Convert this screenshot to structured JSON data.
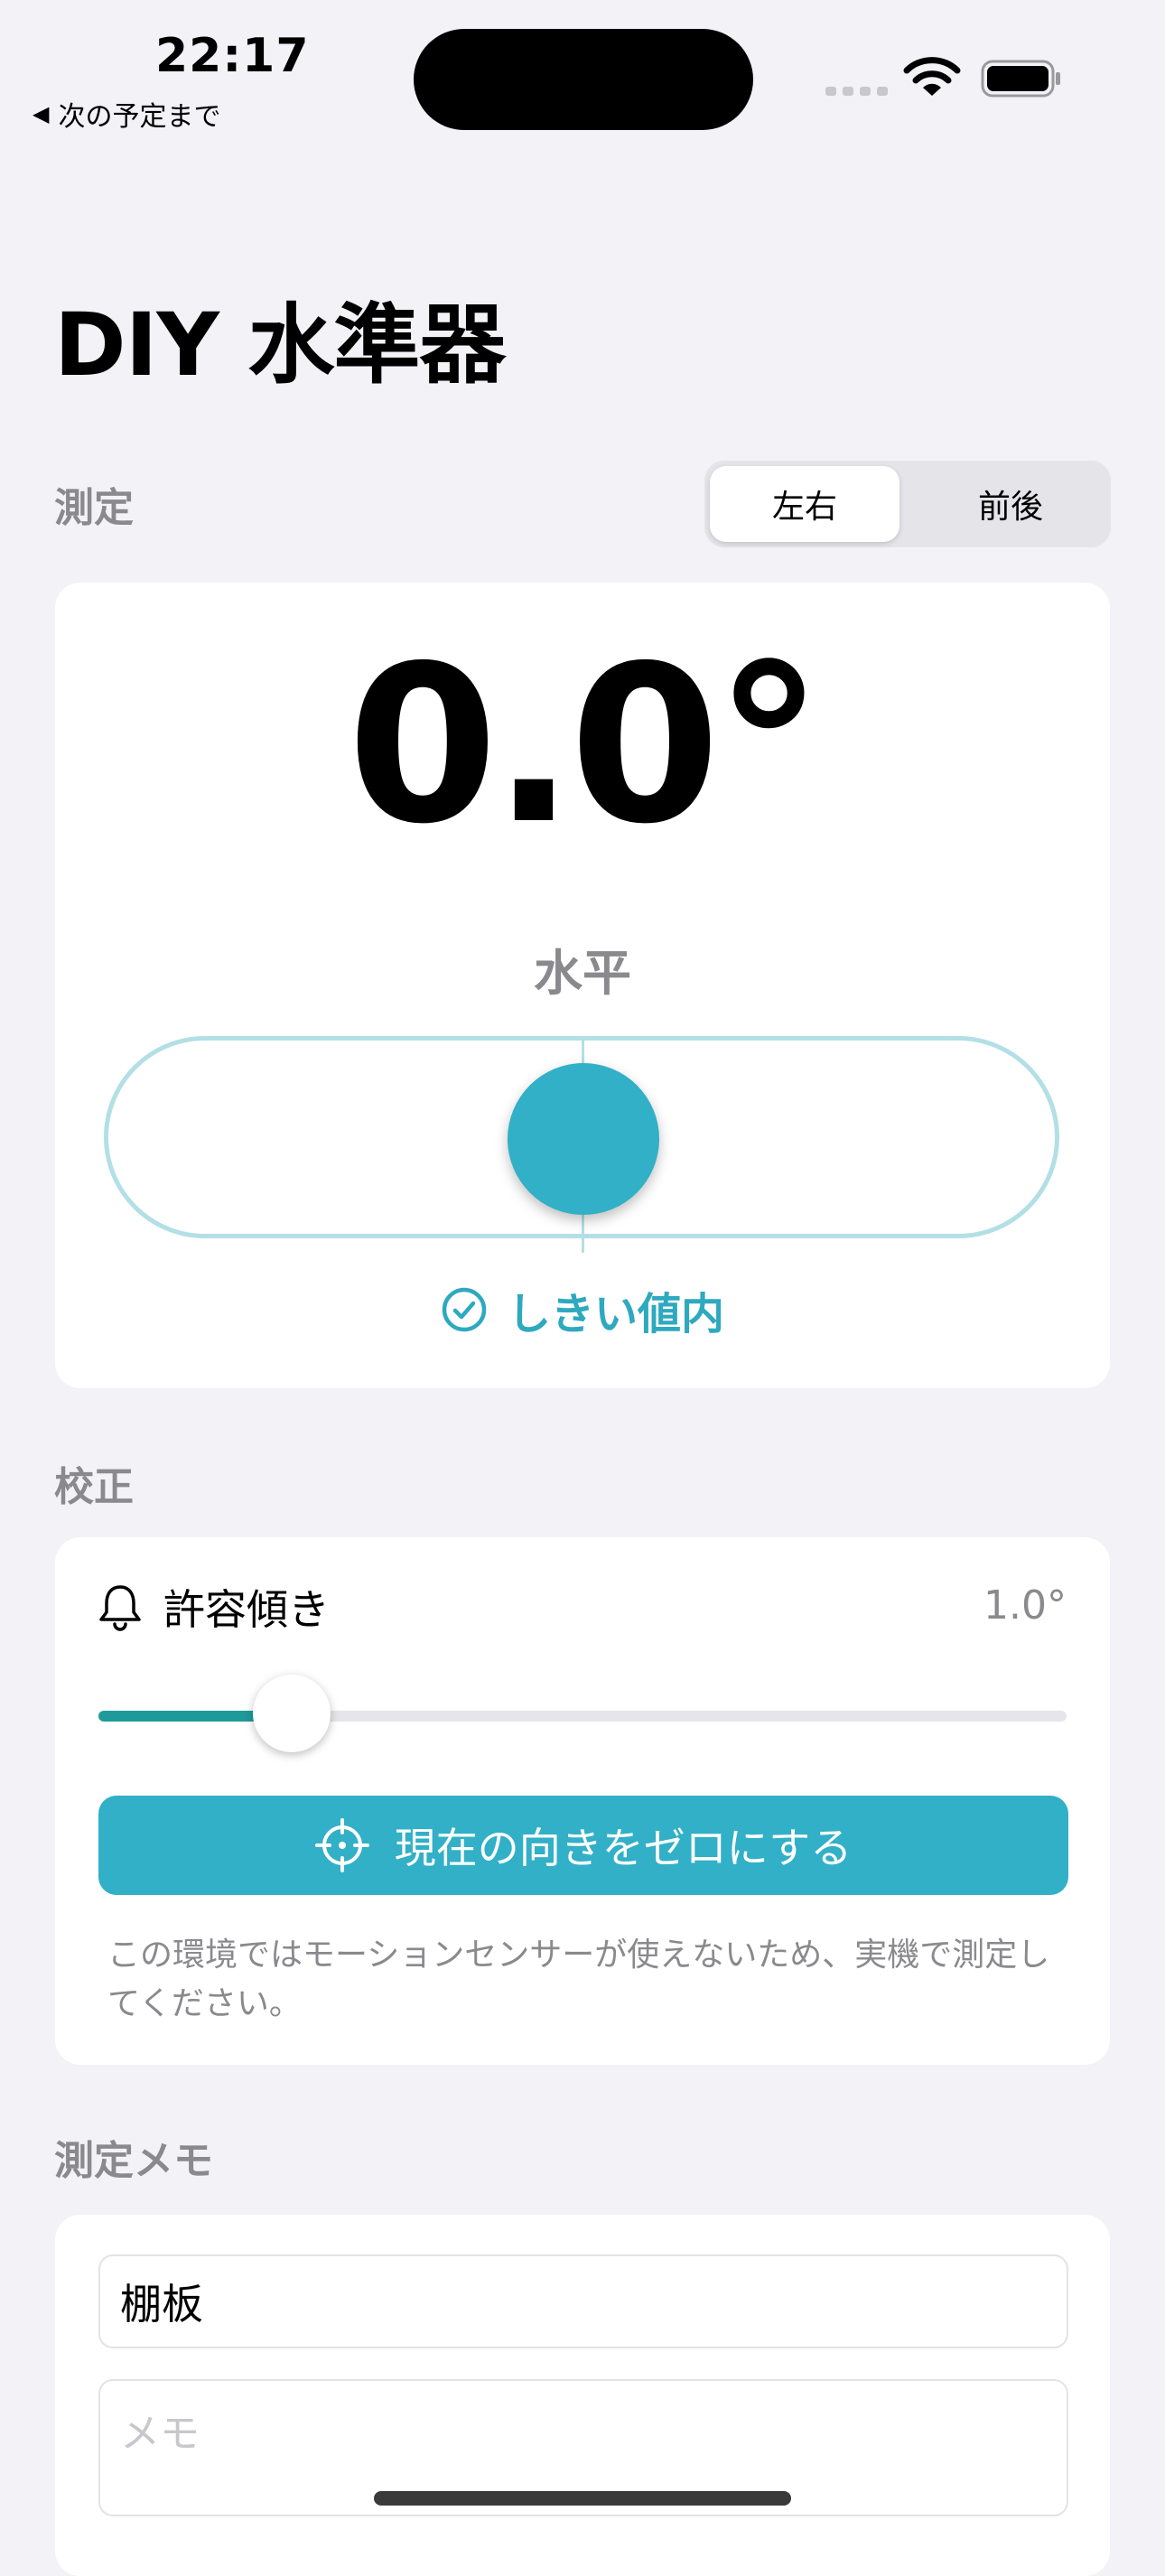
{
  "status_bar": {
    "time": "22:17",
    "back_hint": "次の予定まで"
  },
  "app": {
    "title": "DIY 水準器"
  },
  "measure": {
    "section_label": "測定",
    "segments": [
      "左右",
      "前後"
    ],
    "selected_segment": "左右",
    "angle": "0.0°",
    "state": "水平",
    "threshold_status": "しきい値内",
    "bubble_offset_deg": 0.0,
    "accent_color": "#31b0c7"
  },
  "calibration": {
    "section_label": "校正",
    "tolerance_label": "許容傾き",
    "tolerance_value": "1.0°",
    "slider_fraction": 0.2,
    "zero_button_label": "現在の向きをゼロにする",
    "note": "この環境ではモーションセンサーが使えないため、実機で測定してください。"
  },
  "memo": {
    "section_label": "測定メモ",
    "title_value": "棚板",
    "memo_placeholder": "メモ"
  },
  "icons": {
    "back": "back-triangle-icon",
    "wifi": "wifi-icon",
    "battery": "battery-icon",
    "threshold": "check-circle-icon",
    "tolerance": "bell-icon",
    "zero": "crosshair-icon"
  }
}
